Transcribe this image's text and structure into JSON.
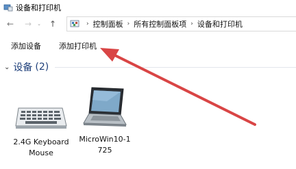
{
  "window": {
    "title": "设备和打印机"
  },
  "navigation": {
    "back_label": "←",
    "forward_label": "→",
    "recent_label": "⌄",
    "up_label": "↑"
  },
  "breadcrumb": {
    "separator": "›",
    "items": [
      "控制面板",
      "所有控制面板项",
      "设备和打印机"
    ]
  },
  "command_bar": {
    "add_device": "添加设备",
    "add_printer": "添加打印机"
  },
  "group": {
    "chevron": "⌄",
    "title": "设备",
    "count": "(2)"
  },
  "devices": [
    {
      "label": "2.4G Keyboard Mouse",
      "icon": "keyboard-icon"
    },
    {
      "label": "MicroWin10-1725",
      "icon": "laptop-icon"
    }
  ],
  "annotation": {
    "arrow_color": "#d94545"
  },
  "colors": {
    "group_title": "#1e3f7a"
  }
}
